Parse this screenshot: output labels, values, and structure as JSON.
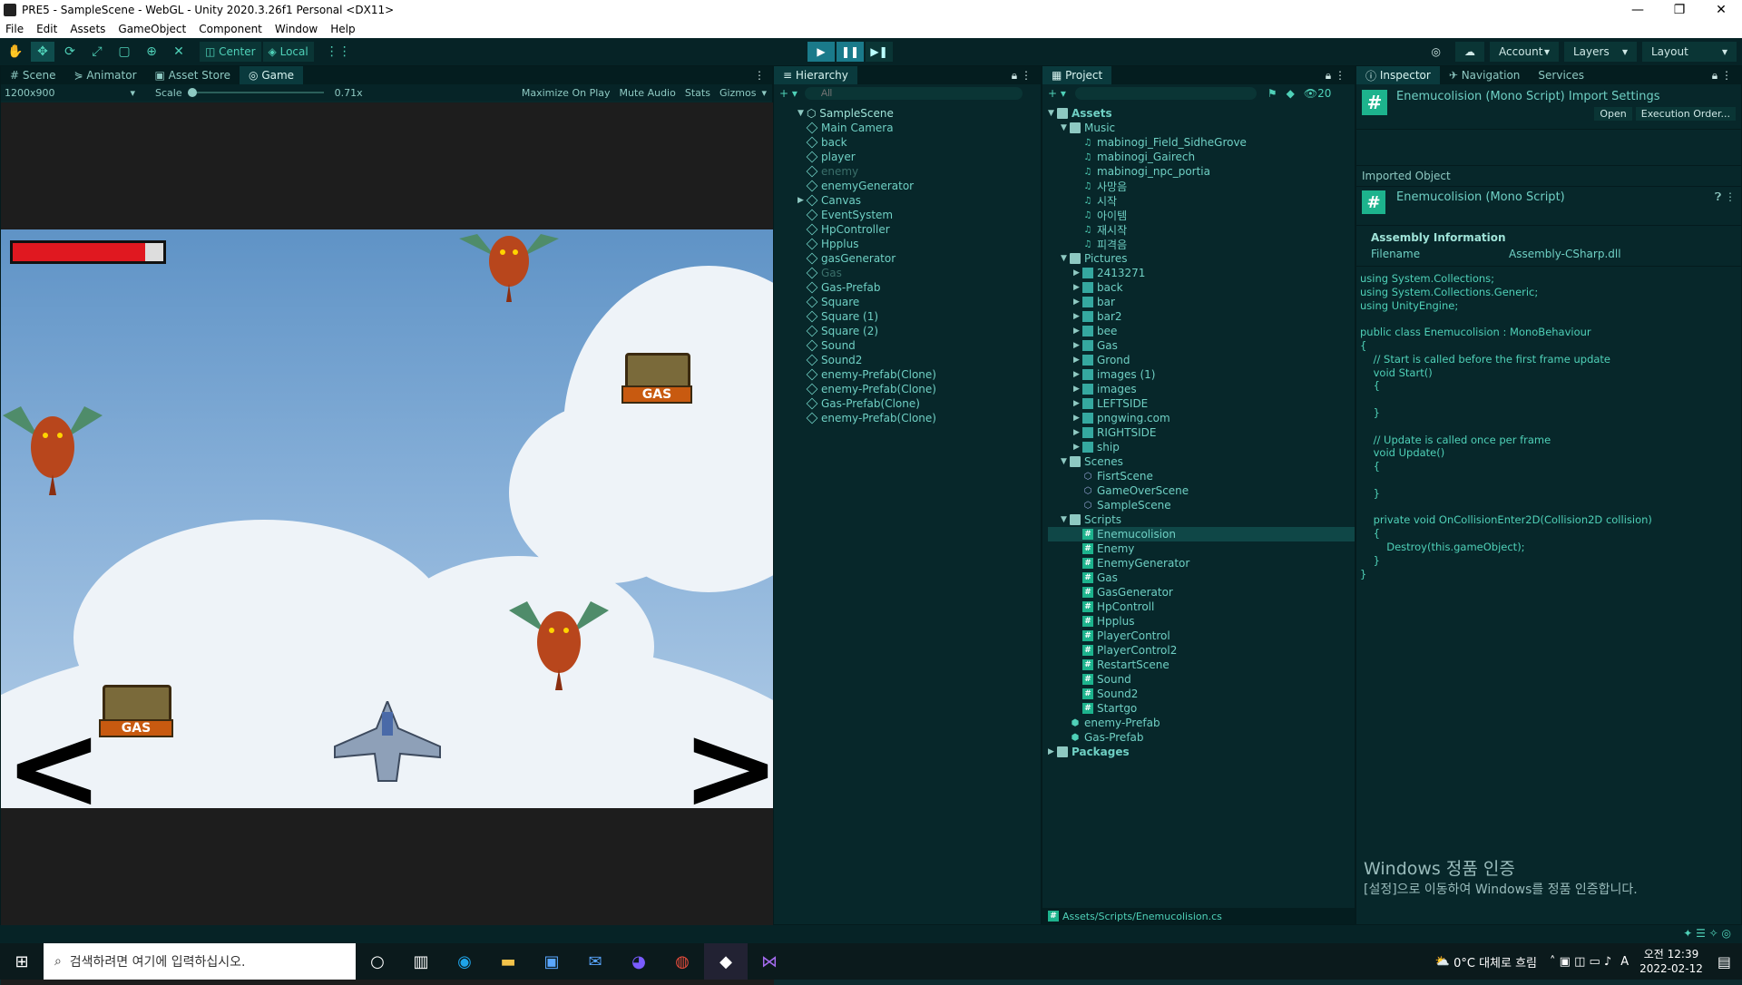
{
  "window": {
    "title": "PRE5 - SampleScene - WebGL - Unity 2020.3.26f1 Personal <DX11>",
    "controls": [
      "—",
      "❐",
      "✕"
    ]
  },
  "menu": [
    "File",
    "Edit",
    "Assets",
    "GameObject",
    "Component",
    "Window",
    "Help"
  ],
  "toolbar": {
    "pivot_center": "Center",
    "pivot_local": "Local",
    "account": "Account",
    "layers": "Layers",
    "layout": "Layout"
  },
  "game_panel": {
    "tabs": [
      "Scene",
      "Animator",
      "Asset Store",
      "Game"
    ],
    "active_tab": "Game",
    "resolution": "1200x900",
    "scale_label": "Scale",
    "scale_value": "0.71x",
    "options": [
      "Maximize On Play",
      "Mute Audio",
      "Stats",
      "Gizmos"
    ],
    "hp_fraction": 0.88,
    "gas_label": "GAS"
  },
  "hierarchy": {
    "tab": "Hierarchy",
    "search_placeholder": "All",
    "scene": "SampleScene",
    "items": [
      {
        "name": "Main Camera",
        "dim": false
      },
      {
        "name": "back",
        "dim": false
      },
      {
        "name": "player",
        "dim": false
      },
      {
        "name": "enemy",
        "dim": true
      },
      {
        "name": "enemyGenerator",
        "dim": false
      },
      {
        "name": "Canvas",
        "dim": false
      },
      {
        "name": "EventSystem",
        "dim": false
      },
      {
        "name": "HpController",
        "dim": false
      },
      {
        "name": "Hpplus",
        "dim": false
      },
      {
        "name": "gasGenerator",
        "dim": false
      },
      {
        "name": "Gas",
        "dim": true
      },
      {
        "name": "Gas-Prefab",
        "dim": false
      },
      {
        "name": "Square",
        "dim": false
      },
      {
        "name": "Square (1)",
        "dim": false
      },
      {
        "name": "Square (2)",
        "dim": false
      },
      {
        "name": "Sound",
        "dim": false
      },
      {
        "name": "Sound2",
        "dim": false
      },
      {
        "name": "enemy-Prefab(Clone)",
        "dim": false
      },
      {
        "name": "enemy-Prefab(Clone)",
        "dim": false
      },
      {
        "name": "Gas-Prefab(Clone)",
        "dim": false
      },
      {
        "name": "enemy-Prefab(Clone)",
        "dim": false
      }
    ]
  },
  "project": {
    "tab": "Project",
    "hidden_count": "20",
    "items": [
      {
        "label": "Assets",
        "type": "folder",
        "depth": 0,
        "bold": true
      },
      {
        "label": "Music",
        "type": "folder",
        "depth": 1
      },
      {
        "label": "mabinogi_Field_SidheGrove",
        "type": "audio",
        "depth": 2
      },
      {
        "label": "mabinogi_Gairech",
        "type": "audio",
        "depth": 2
      },
      {
        "label": "mabinogi_npc_portia",
        "type": "audio",
        "depth": 2
      },
      {
        "label": "사망음",
        "type": "audio",
        "depth": 2
      },
      {
        "label": "시작",
        "type": "audio",
        "depth": 2
      },
      {
        "label": "아이템",
        "type": "audio",
        "depth": 2
      },
      {
        "label": "재시작",
        "type": "audio",
        "depth": 2
      },
      {
        "label": "피격음",
        "type": "audio",
        "depth": 2
      },
      {
        "label": "Pictures",
        "type": "folder",
        "depth": 1
      },
      {
        "label": "2413271",
        "type": "image",
        "depth": 2
      },
      {
        "label": "back",
        "type": "image",
        "depth": 2
      },
      {
        "label": "bar",
        "type": "image",
        "depth": 2
      },
      {
        "label": "bar2",
        "type": "image",
        "depth": 2
      },
      {
        "label": "bee",
        "type": "image",
        "depth": 2
      },
      {
        "label": "Gas",
        "type": "image",
        "depth": 2
      },
      {
        "label": "Grond",
        "type": "image",
        "depth": 2
      },
      {
        "label": "images (1)",
        "type": "image",
        "depth": 2
      },
      {
        "label": "images",
        "type": "image",
        "depth": 2
      },
      {
        "label": "LEFTSIDE",
        "type": "image",
        "depth": 2
      },
      {
        "label": "pngwing.com",
        "type": "image",
        "depth": 2
      },
      {
        "label": "RIGHTSIDE",
        "type": "image",
        "depth": 2
      },
      {
        "label": "ship",
        "type": "image",
        "depth": 2
      },
      {
        "label": "Scenes",
        "type": "folder",
        "depth": 1
      },
      {
        "label": "FisrtScene",
        "type": "scene",
        "depth": 2
      },
      {
        "label": "GameOverScene",
        "type": "scene",
        "depth": 2
      },
      {
        "label": "SampleScene",
        "type": "scene",
        "depth": 2
      },
      {
        "label": "Scripts",
        "type": "folder",
        "depth": 1
      },
      {
        "label": "Enemucolision",
        "type": "script",
        "depth": 2,
        "selected": true
      },
      {
        "label": "Enemy",
        "type": "script",
        "depth": 2
      },
      {
        "label": "EnemyGenerator",
        "type": "script",
        "depth": 2
      },
      {
        "label": "Gas",
        "type": "script",
        "depth": 2
      },
      {
        "label": "GasGenerator",
        "type": "script",
        "depth": 2
      },
      {
        "label": "HpControll",
        "type": "script",
        "depth": 2
      },
      {
        "label": "Hpplus",
        "type": "script",
        "depth": 2
      },
      {
        "label": "PlayerControl",
        "type": "script",
        "depth": 2
      },
      {
        "label": "PlayerControl2",
        "type": "script",
        "depth": 2
      },
      {
        "label": "RestartScene",
        "type": "script",
        "depth": 2
      },
      {
        "label": "Sound",
        "type": "script",
        "depth": 2
      },
      {
        "label": "Sound2",
        "type": "script",
        "depth": 2
      },
      {
        "label": "Startgo",
        "type": "script",
        "depth": 2
      },
      {
        "label": "enemy-Prefab",
        "type": "prefab",
        "depth": 1
      },
      {
        "label": "Gas-Prefab",
        "type": "prefab",
        "depth": 1
      },
      {
        "label": "Packages",
        "type": "folder",
        "depth": 0,
        "bold": true
      }
    ],
    "path": "Assets/Scripts/Enemucolision.cs"
  },
  "inspector": {
    "tabs": [
      "Inspector",
      "Navigation",
      "Services"
    ],
    "header_title": "Enemucolision (Mono Script) Import Settings",
    "open_button": "Open",
    "exec_order_button": "Execution Order...",
    "imported_object": "Imported Object",
    "object_title": "Enemucolision (Mono Script)",
    "assembly_info": "Assembly Information",
    "filename_label": "Filename",
    "filename_value": "Assembly-CSharp.dll",
    "code": "using System.Collections;\nusing System.Collections.Generic;\nusing UnityEngine;\n\npublic class Enemucolision : MonoBehaviour\n{\n    // Start is called before the first frame update\n    void Start()\n    {\n\n    }\n\n    // Update is called once per frame\n    void Update()\n    {\n\n    }\n\n    private void OnCollisionEnter2D(Collision2D collision)\n    {\n        Destroy(this.gameObject);\n    }\n}",
    "watermark_title": "Windows 정품 인증",
    "watermark_sub": "[설정]으로 이동하여 Windows를 정품 인증합니다."
  },
  "taskbar": {
    "search_placeholder": "검색하려면 여기에 입력하십시오.",
    "weather": "0°C  대체로 흐림",
    "time": "오전 12:39",
    "date": "2022-02-12",
    "ime": "A"
  },
  "colors": {
    "accent": "#4fd1b8",
    "panel_bg": "#07272a",
    "hp_red": "#e01820"
  }
}
